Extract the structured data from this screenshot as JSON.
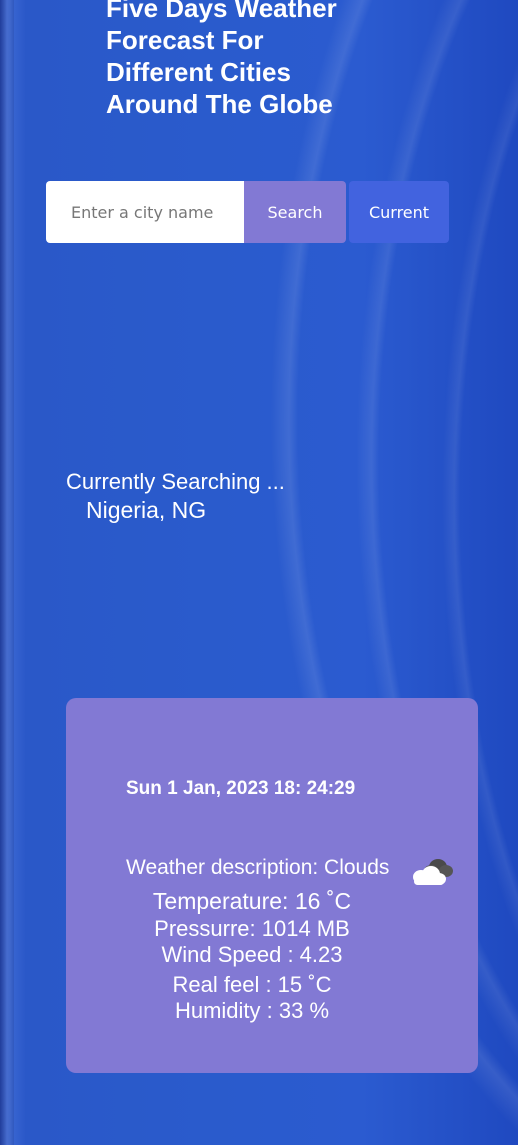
{
  "header": {
    "title_line1": "Five Days Weather",
    "title_line2": "Forecast For",
    "title_line3": "Different Cities",
    "title_line4": "Around The Globe"
  },
  "search": {
    "placeholder": "Enter a city name",
    "value": "",
    "search_label": "Search",
    "current_label": "Current"
  },
  "status": {
    "label": "Currently Searching ...",
    "location": "Nigeria, NG"
  },
  "weather": {
    "date": "Sun 1 Jan, 2023 18: 24:29",
    "description": "Weather description: Clouds",
    "icon": "cloud-icon",
    "temperature": "Temperature: 16 ˚C",
    "pressure": "Pressurre: 1014 MB",
    "wind": "Wind Speed : 4.23",
    "real_feel": "Real feel : 15 ˚C",
    "humidity": "Humidity : 33 %"
  },
  "colors": {
    "background": "#2a5bcc",
    "card": "#8279d4",
    "search_button": "#8279d4",
    "current_button": "#4263df"
  }
}
